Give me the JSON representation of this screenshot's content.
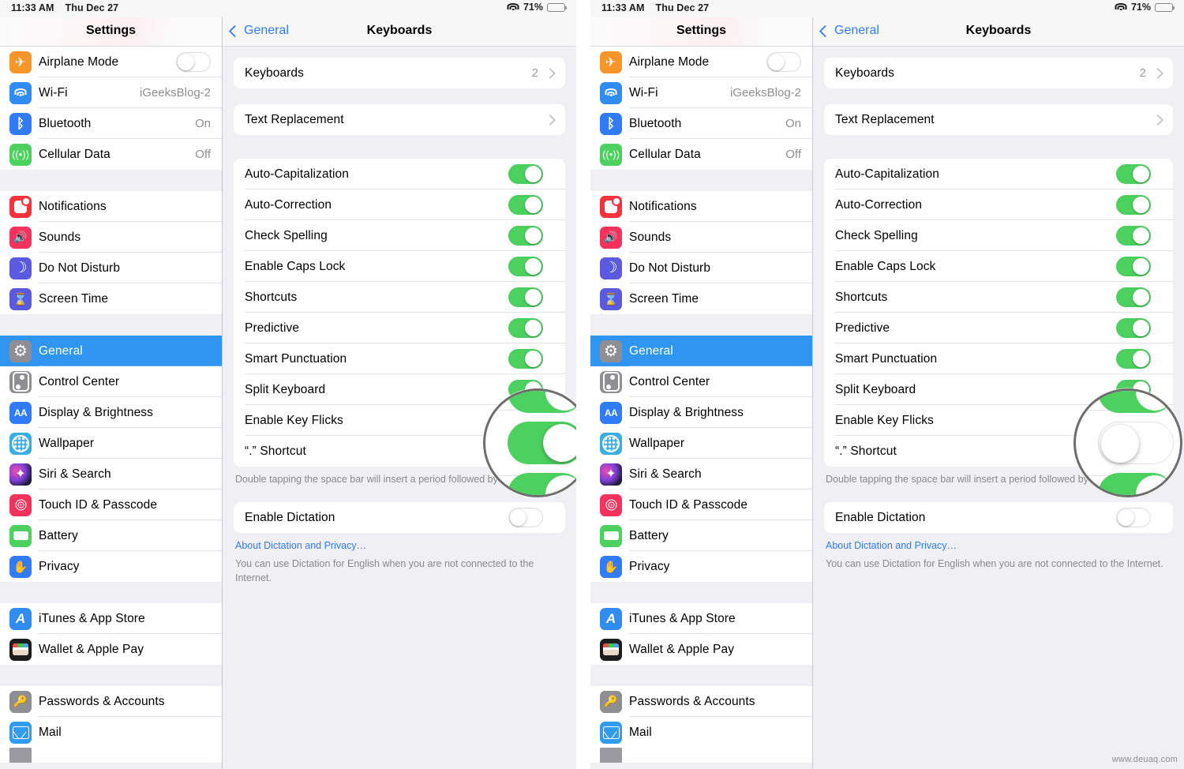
{
  "watermark": "www.deuaq.com",
  "status_bar": {
    "time": "11:33 AM",
    "date": "Thu Dec 27",
    "battery_percent": "71%",
    "wifi_icon": "wifi-icon",
    "battery_icon": "battery-icon"
  },
  "sidebar": {
    "title": "Settings",
    "groups": [
      {
        "items": [
          {
            "label": "Airplane Mode",
            "icon": "airplane-icon",
            "color": "#f8952a",
            "control": "toggle",
            "value": "off"
          },
          {
            "label": "Wi-Fi",
            "icon": "wifi-icon",
            "color": "#2f8cf0",
            "value": "iGeeksBlog-2"
          },
          {
            "label": "Bluetooth",
            "icon": "bluetooth-icon",
            "color": "#2f7cf6",
            "value": "On"
          },
          {
            "label": "Cellular Data",
            "icon": "cellular-icon",
            "color": "#4cd15f",
            "value": "Off"
          }
        ]
      },
      {
        "items": [
          {
            "label": "Notifications",
            "icon": "notifications-icon",
            "color": "#f4323c"
          },
          {
            "label": "Sounds",
            "icon": "sounds-icon",
            "color": "#f4325c"
          },
          {
            "label": "Do Not Disturb",
            "icon": "do-not-disturb-icon",
            "color": "#5a5ae0"
          },
          {
            "label": "Screen Time",
            "icon": "screen-time-icon",
            "color": "#5a5ae0"
          }
        ]
      },
      {
        "items": [
          {
            "label": "General",
            "icon": "gear-icon",
            "color": "#8e8e93",
            "selected": true
          },
          {
            "label": "Control Center",
            "icon": "control-center-icon",
            "color": "#8e8e93"
          },
          {
            "label": "Display & Brightness",
            "icon": "display-brightness-icon",
            "color": "#2f7cf6"
          },
          {
            "label": "Wallpaper",
            "icon": "wallpaper-icon",
            "color": "#3aaee0"
          },
          {
            "label": "Siri & Search",
            "icon": "siri-icon",
            "color": "#1b1b3a"
          },
          {
            "label": "Touch ID & Passcode",
            "icon": "touch-id-icon",
            "color": "#f4325c"
          },
          {
            "label": "Battery",
            "icon": "battery-icon",
            "color": "#4cd15f"
          },
          {
            "label": "Privacy",
            "icon": "privacy-icon",
            "color": "#2f7cf6"
          }
        ]
      },
      {
        "items": [
          {
            "label": "iTunes & App Store",
            "icon": "app-store-icon",
            "color": "#2f8cf0"
          },
          {
            "label": "Wallet & Apple Pay",
            "icon": "wallet-icon",
            "color": "#1c1c1e"
          }
        ]
      },
      {
        "items": [
          {
            "label": "Passwords & Accounts",
            "icon": "passwords-icon",
            "color": "#8e8e93"
          },
          {
            "label": "Mail",
            "icon": "mail-icon",
            "color": "#2f9cf0"
          }
        ]
      }
    ]
  },
  "detail": {
    "back_label": "General",
    "title": "Keyboards",
    "nav_rows": [
      {
        "label": "Keyboards",
        "value": "2",
        "chevron": true
      },
      {
        "label": "Text Replacement",
        "value": "",
        "chevron": true
      }
    ],
    "toggle_rows_left": [
      {
        "label": "Auto-Capitalization",
        "value": "on"
      },
      {
        "label": "Auto-Correction",
        "value": "on"
      },
      {
        "label": "Check Spelling",
        "value": "on"
      },
      {
        "label": "Enable Caps Lock",
        "value": "on"
      },
      {
        "label": "Shortcuts",
        "value": "on"
      },
      {
        "label": "Predictive",
        "value": "on"
      },
      {
        "label": "Smart Punctuation",
        "value": "on"
      },
      {
        "label": "Split Keyboard",
        "value": "on"
      },
      {
        "label": "Enable Key Flicks",
        "value": "on"
      },
      {
        "label": "“.” Shortcut",
        "value": "on"
      }
    ],
    "toggle_rows_right": [
      {
        "label": "Auto-Capitalization",
        "value": "on"
      },
      {
        "label": "Auto-Correction",
        "value": "on"
      },
      {
        "label": "Check Spelling",
        "value": "on"
      },
      {
        "label": "Enable Caps Lock",
        "value": "on"
      },
      {
        "label": "Shortcuts",
        "value": "on"
      },
      {
        "label": "Predictive",
        "value": "on"
      },
      {
        "label": "Smart Punctuation",
        "value": "on"
      },
      {
        "label": "Split Keyboard",
        "value": "on"
      },
      {
        "label": "Enable Key Flicks",
        "value": "off"
      },
      {
        "label": "“.” Shortcut",
        "value": "on"
      }
    ],
    "period_footnote": "Double tapping the space bar will insert a period followed by a space.",
    "dictation_label": "Enable Dictation",
    "dictation_value": "off",
    "dictation_link": "About Dictation and Privacy…",
    "dictation_footnote": "You can use Dictation for English when you are not connected to the Internet."
  },
  "callouts": {
    "left": {
      "target": "Enable Key Flicks",
      "state": "on"
    },
    "right": {
      "target": "Enable Key Flicks",
      "state": "off"
    }
  },
  "colors": {
    "accent_blue": "#2f7cf6",
    "selection_blue": "#2f95f0",
    "toggle_green": "#4cd15f",
    "group_bg": "#efeff4",
    "separator": "#e4e4e8"
  }
}
